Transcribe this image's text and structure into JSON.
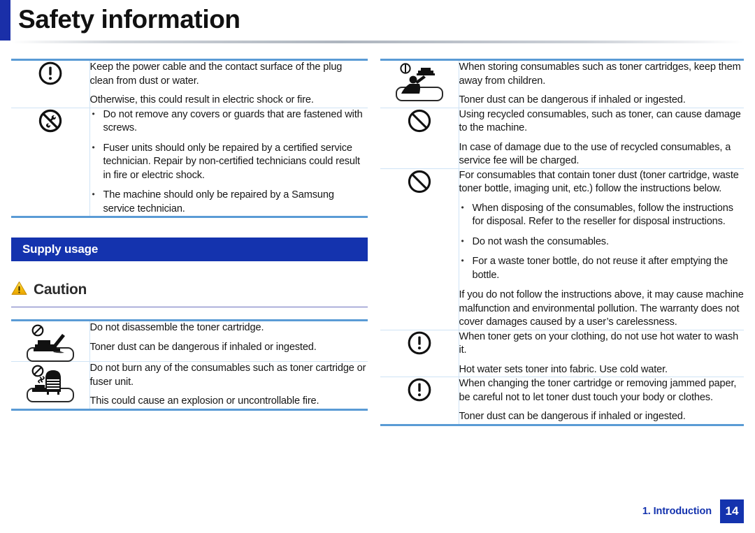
{
  "header": {
    "title": "Safety information",
    "accent_color": "#1a2fa8"
  },
  "colors": {
    "table_border": "#5a9bd5",
    "row_divider": "#cfe3f5",
    "section_bar": "#1433ae",
    "caution_rule": "#6a6fbe",
    "footer_blue": "#1433ae",
    "caution_triangle": "#f5c21b"
  },
  "left_column": {
    "top_table": {
      "rows": [
        {
          "icon": "exclamation-in-circle-icon",
          "paragraphs": [
            "Keep the power cable and the contact surface of the plug clean from dust or water.",
            "Otherwise, this could result in electric shock or fire."
          ],
          "bullets": []
        },
        {
          "icon": "no-disassembly-tools-icon",
          "paragraphs": [],
          "bullets": [
            "Do not remove any covers or guards that are fastened with screws.",
            "Fuser units should only be repaired by a certified service technician. Repair by non-certified technicians could result in fire or electric shock.",
            "The machine should only be repaired by a Samsung service technician."
          ]
        }
      ]
    },
    "section_bar_label": "Supply usage",
    "caution_label": "Caution",
    "caution_icon": "warning-triangle-icon",
    "caution_table": {
      "rows": [
        {
          "icon": "no-disassemble-toner-cartridge-icon",
          "paragraphs": [
            "Do not disassemble the toner cartridge.",
            "Toner dust can be dangerous if inhaled or ingested."
          ],
          "bullets": []
        },
        {
          "icon": "no-burning-consumables-icon",
          "paragraphs": [
            "Do not burn any of the consumables such as toner cartridge or fuser unit.",
            "This could cause an explosion or uncontrollable fire."
          ],
          "bullets": []
        }
      ]
    }
  },
  "right_column": {
    "table": {
      "rows": [
        {
          "icon": "keep-away-from-children-icon",
          "paragraphs": [
            "When storing consumables such as toner cartridges, keep them away from children.",
            "Toner dust can be dangerous if inhaled or ingested."
          ],
          "bullets": []
        },
        {
          "icon": "prohibition-circle-icon",
          "paragraphs": [
            "Using recycled consumables, such as toner, can cause damage to the machine.",
            "In case of damage due to the use of recycled consumables, a service fee will be charged."
          ],
          "bullets": []
        },
        {
          "icon": "prohibition-circle-icon",
          "paragraphs": [
            "For consumables that contain toner dust (toner cartridge, waste toner bottle, imaging unit, etc.) follow the instructions below."
          ],
          "bullets": [
            "When disposing of the consumables, follow the instructions for disposal. Refer to the reseller for disposal instructions.",
            "Do not wash the consumables.",
            "For a waste toner bottle, do not reuse it after emptying the bottle."
          ],
          "paragraphs_after": [
            "If you do not follow the instructions above, it may cause machine malfunction and environmental pollution.  The warranty does not cover damages caused by a user’s carelessness."
          ]
        },
        {
          "icon": "exclamation-in-circle-icon",
          "paragraphs": [
            "When toner gets on your clothing, do not use hot water to wash it.",
            "Hot water sets toner into fabric. Use cold water."
          ],
          "bullets": []
        },
        {
          "icon": "exclamation-in-circle-icon",
          "paragraphs": [
            "When changing the toner cartridge or removing jammed paper, be careful not to let toner dust touch your body or clothes.",
            "Toner dust can be dangerous if inhaled or ingested."
          ],
          "bullets": []
        }
      ]
    }
  },
  "footer": {
    "chapter": "1. Introduction",
    "page_number": "14"
  }
}
